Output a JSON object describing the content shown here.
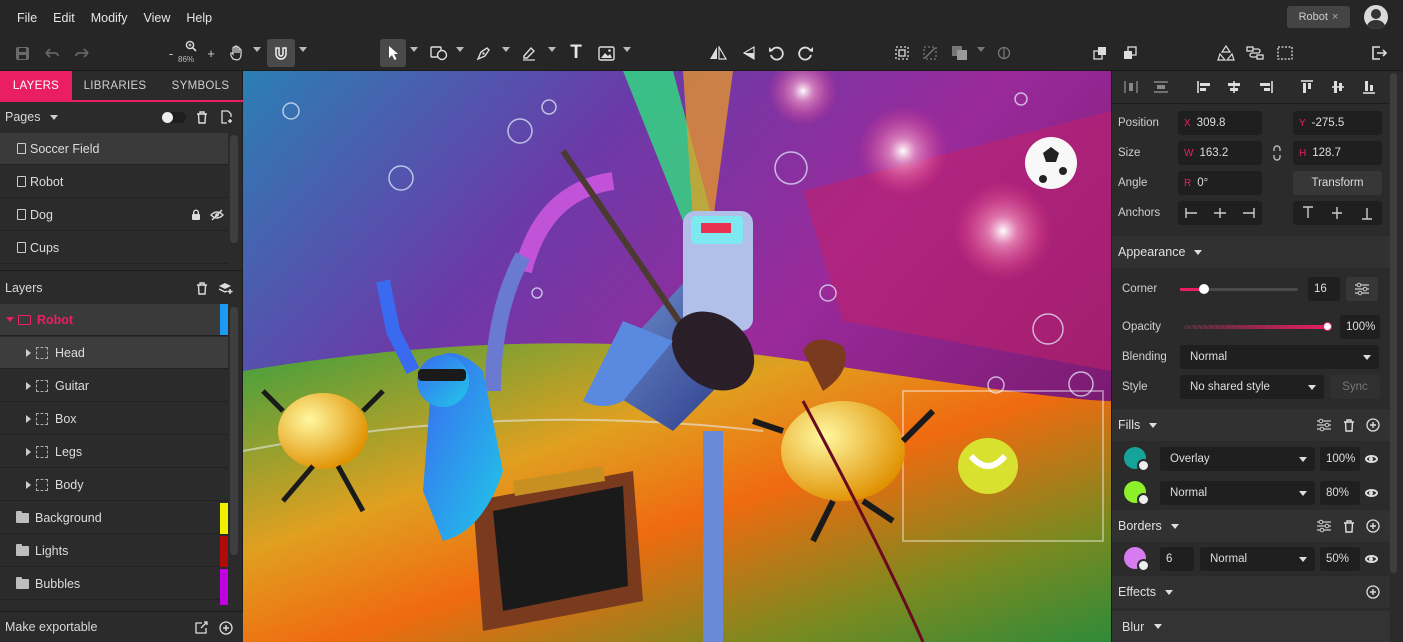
{
  "menu": [
    "File",
    "Edit",
    "Modify",
    "View",
    "Help"
  ],
  "document_tab": {
    "title": "Robot",
    "close": "×"
  },
  "toolbar": {
    "zoom_label": "86%",
    "zoom_minus": "-",
    "zoom_plus": "+",
    "text_tool": "T"
  },
  "left_panel": {
    "tabs": [
      "LAYERS",
      "LIBRARIES",
      "SYMBOLS"
    ],
    "pages_label": "Pages",
    "pages": [
      {
        "label": "Soccer Field",
        "selected": true
      },
      {
        "label": "Robot"
      },
      {
        "label": "Dog",
        "locked": true,
        "hidden": true
      },
      {
        "label": "Cups"
      }
    ],
    "layers_label": "Layers",
    "layers": [
      {
        "label": "Robot",
        "type": "group",
        "expanded": true,
        "tag_color": "#1e9bf0"
      },
      {
        "label": "Head",
        "type": "part",
        "selected": true
      },
      {
        "label": "Guitar",
        "type": "part"
      },
      {
        "label": "Box",
        "type": "part"
      },
      {
        "label": "Legs",
        "type": "part"
      },
      {
        "label": "Body",
        "type": "part"
      },
      {
        "label": "Background",
        "type": "folder",
        "tag_color": "#f0f000"
      },
      {
        "label": "Lights",
        "type": "folder",
        "tag_color": "#b00a0a"
      },
      {
        "label": "Bubbles",
        "type": "folder",
        "tag_color": "#c000e0"
      }
    ],
    "footer_label": "Make exportable"
  },
  "right_panel": {
    "position": {
      "label": "Position",
      "x_prefix": "X",
      "x": "309.8",
      "y_prefix": "Y",
      "y": "-275.5"
    },
    "size": {
      "label": "Size",
      "w_prefix": "W",
      "w": "163.2",
      "h_prefix": "H",
      "h": "128.7"
    },
    "angle": {
      "label": "Angle",
      "r_prefix": "R",
      "value": "0°",
      "transform_button": "Transform"
    },
    "anchors_label": "Anchors",
    "appearance": {
      "header": "Appearance",
      "corner_label": "Corner",
      "corner_value": "16",
      "corner_fraction": 0.2,
      "opacity_label": "Opacity",
      "opacity_value": "100%",
      "opacity_fraction": 1.0,
      "blending_label": "Blending",
      "blending_value": "Normal",
      "style_label": "Style",
      "style_value": "No shared style",
      "sync_button": "Sync"
    },
    "fills": {
      "header": "Fills",
      "items": [
        {
          "color": "#16a39a",
          "mode": "Overlay",
          "opacity": "100%"
        },
        {
          "color": "#8ef02a",
          "mode": "Normal",
          "opacity": "80%"
        }
      ]
    },
    "borders": {
      "header": "Borders",
      "items": [
        {
          "color": "#d77cf0",
          "width": "6",
          "mode": "Normal",
          "opacity": "50%"
        }
      ]
    },
    "effects": {
      "header": "Effects",
      "blur_label": "Blur"
    }
  },
  "colors": {
    "accent": "#e91e63",
    "panel": "#2b2b2b",
    "field": "#1f1f1f"
  }
}
